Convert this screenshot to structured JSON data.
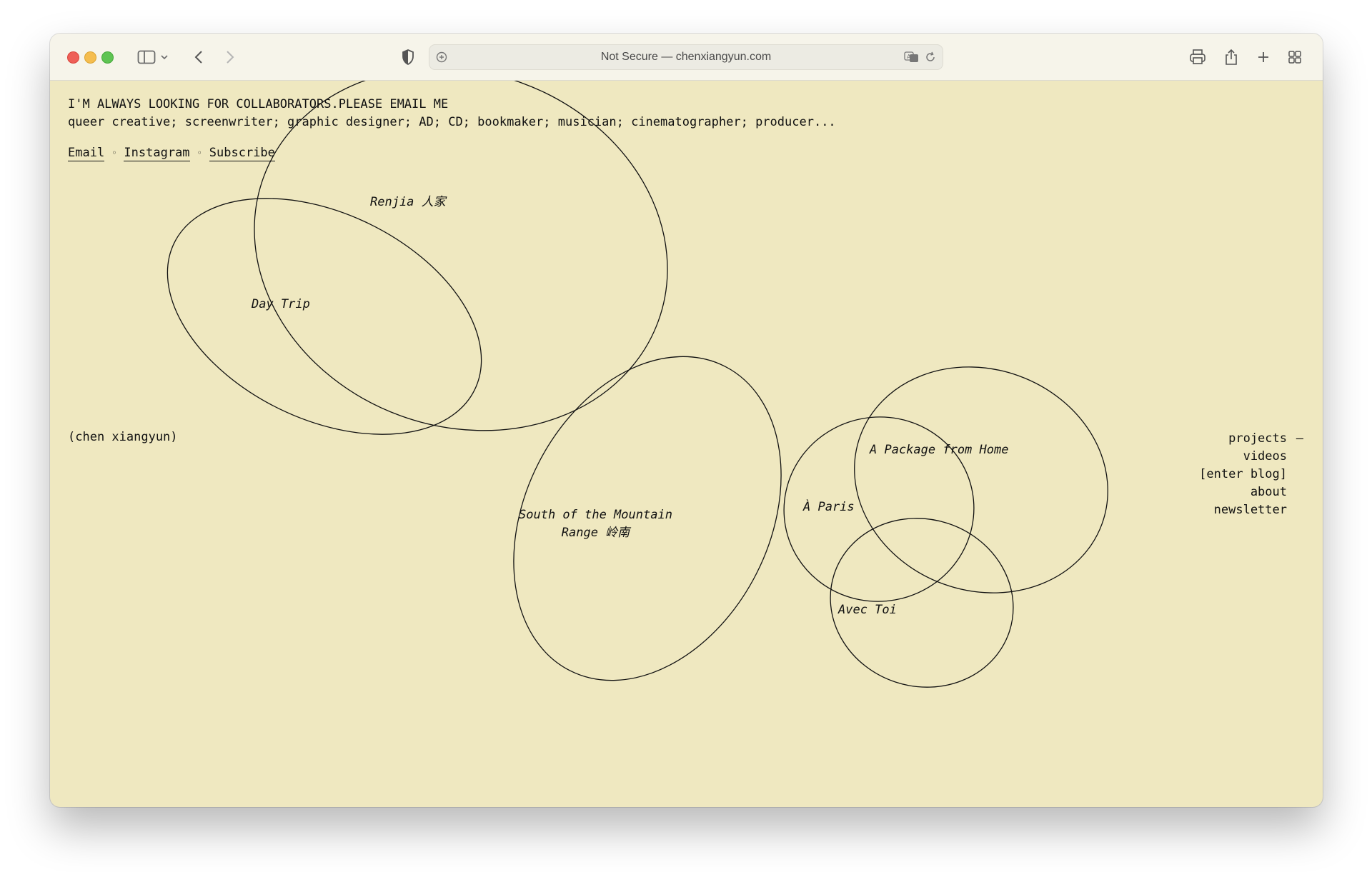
{
  "browser": {
    "address": "Not Secure — chenxiangyun.com"
  },
  "header": {
    "line1": "I'M ALWAYS LOOKING FOR COLLABORATORS.PLEASE EMAIL ME",
    "line2": "queer creative; screenwriter; graphic designer; AD; CD; bookmaker; musician; cinematographer; producer...",
    "links": {
      "email": "Email",
      "instagram": "Instagram",
      "subscribe": "Subscribe",
      "separator": "◦"
    }
  },
  "site_name": "(chen xiangyun)",
  "projects": {
    "renjia": "Renjia 人家",
    "day_trip": "Day Trip",
    "south_line1": "South of the Mountain",
    "south_line2": "Range 岭南",
    "package": "A Package from Home",
    "paris": "À Paris",
    "avec_toi": "Avec Toi"
  },
  "nav": {
    "projects": "projects",
    "projects_marker": "—",
    "videos": "videos",
    "blog": "[enter blog]",
    "about": "about",
    "newsletter": "newsletter"
  },
  "colors": {
    "page_background": "#efe8c0",
    "ink": "#111111"
  }
}
